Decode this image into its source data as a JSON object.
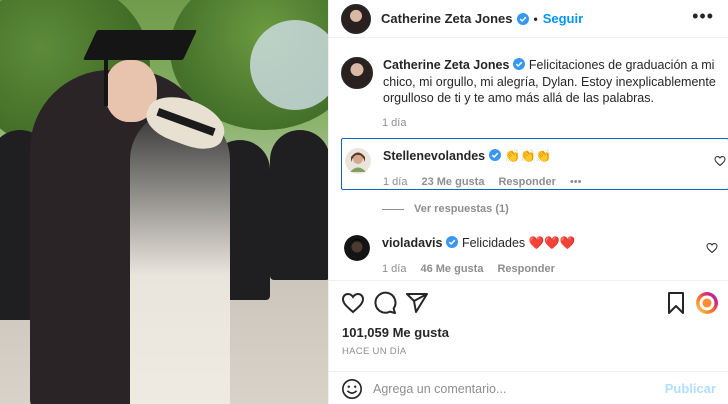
{
  "post": {
    "author": "Catherine Zeta Jones",
    "follow_label": "Seguir",
    "separator": "•",
    "more_label": "•••"
  },
  "caption": {
    "author": "Catherine Zeta Jones",
    "text": "Felicitaciones de graduación a mi chico, mi orgullo, mi alegría, Dylan. Estoy inexplicablemente orgulloso de ti y te amo más allá de las palabras.",
    "time": "1 día"
  },
  "comments": [
    {
      "username": "Stellenevolandes",
      "text": "👏👏👏",
      "time": "1 día",
      "likes": "23 Me gusta",
      "reply": "Responder",
      "more": "•••",
      "verified": true
    },
    {
      "username": "violadavis",
      "text": "Felicidades ❤️❤️❤️",
      "time": "1 día",
      "likes": "46 Me gusta",
      "reply": "Responder",
      "verified": true
    }
  ],
  "view_replies": "Ver respuestas (1)",
  "actions": {
    "icons": [
      "heart-icon",
      "comment-icon",
      "share-icon",
      "bookmark-icon",
      "profile-badge-icon"
    ],
    "likes_count": "101,059 Me gusta",
    "time_ago": "HACE UN DÍA"
  },
  "add_comment": {
    "placeholder": "Agrega un comentario...",
    "publish_label": "Publicar"
  },
  "colors": {
    "link_blue": "#0095f6",
    "verified_blue": "#3897f0",
    "selection_border": "#0f66c2",
    "muted": "#8e8e8e",
    "publish_disabled": "#b2dffc"
  }
}
